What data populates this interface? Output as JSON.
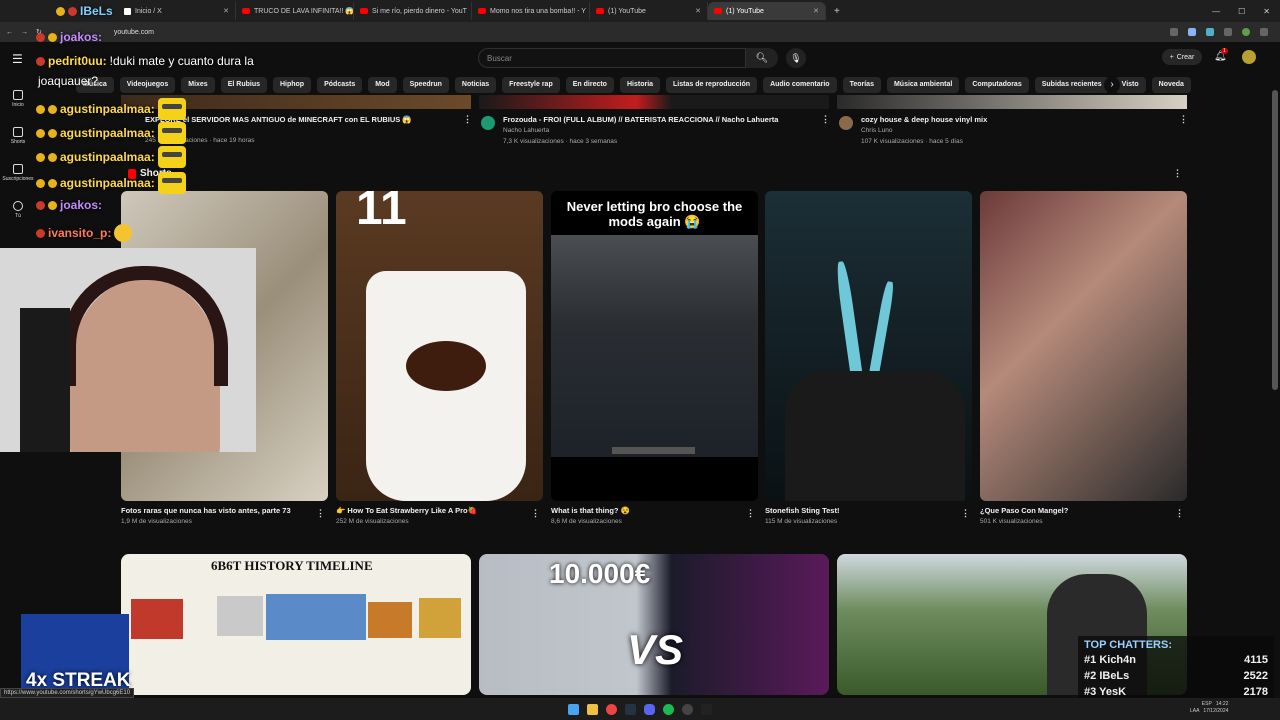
{
  "browser": {
    "tabs": [
      {
        "label": "Inicio / X",
        "icon": "x-icon"
      },
      {
        "label": "TRUCO DE LAVA INFINITA!! 😱",
        "icon": "youtube-icon"
      },
      {
        "label": "Si me río, pierdo dinero - YouT",
        "icon": "youtube-icon"
      },
      {
        "label": "Momo nos tira una bomba!! - Y",
        "icon": "youtube-icon"
      },
      {
        "label": "(1) YouTube",
        "icon": "youtube-icon"
      },
      {
        "label": "(1) YouTube",
        "icon": "youtube-icon",
        "active": true
      }
    ],
    "new_tab": "+",
    "url": "youtube.com"
  },
  "youtube": {
    "search_placeholder": "Buscar",
    "create_label": "Crear",
    "notif_count": "1",
    "chips": [
      "Música",
      "Videojuegos",
      "Mixes",
      "El Rubius",
      "Hiphop",
      "Pódcasts",
      "Mod",
      "Speedrun",
      "Noticias",
      "Freestyle rap",
      "En directo",
      "Historia",
      "Listas de reproducción",
      "Audio comentario",
      "Teorías",
      "Música ambiental",
      "Computadoras",
      "Subidas recientes",
      "Visto",
      "Noveda"
    ],
    "sidebar": [
      {
        "label": "Inicio",
        "icon": "home-icon"
      },
      {
        "label": "Shorts",
        "icon": "shorts-icon"
      },
      {
        "label": "Suscripciones",
        "icon": "subscriptions-icon"
      },
      {
        "label": "Tú",
        "icon": "you-icon"
      }
    ],
    "top_row": [
      {
        "title": "EXPLORE el SERVIDOR MAS ANTIGUO de MINECRAFT con EL RUBIUS 😱",
        "meta": "245 K visualizaciones · hace 19 horas"
      },
      {
        "title": "Frozouda - FROI (FULL ALBUM) // BATERISTA REACCIONA // Nacho Lahuerta",
        "channel": "Nacho Lahuerta",
        "meta": "7,3 K visualizaciones · hace 3 semanas"
      },
      {
        "title": "cozy house & deep house vinyl mix",
        "channel": "Chris Luno",
        "meta": "107 K visualizaciones · hace 5 días"
      }
    ],
    "shorts_label": "Shorts",
    "shorts": [
      {
        "title": "Fotos raras que nunca has visto antes, parte 73",
        "views": "1,9 M de visualizaciones"
      },
      {
        "title": "👉 How To Eat Strawberry Like A Pro🍓",
        "views": "252 M de visualizaciones",
        "overlay": "11"
      },
      {
        "title": "What is that thing? 😵",
        "views": "8,6 M de visualizaciones",
        "overlay": "Never letting bro choose the mods again 😭"
      },
      {
        "title": "Stonefish Sting Test!",
        "views": "115 M de visualizaciones"
      },
      {
        "title": "¿Que Paso Con Mangel?",
        "views": "501 K visualizaciones"
      }
    ],
    "bottom_row": [
      {
        "overlay": "6B6T HISTORY TIMELINE"
      },
      {
        "overlay": "10.000€",
        "overlay2": "VS"
      },
      {
        "overlay": ""
      }
    ],
    "status_url": "https://www.youtube.com/shorts/gYwUbcg6E10"
  },
  "stream": {
    "chat": [
      {
        "user": "IBeLs",
        "text": ""
      },
      {
        "user": "joakos:",
        "text": ""
      },
      {
        "user": "pedrit0uu:",
        "text": "!duki mate y cuanto dura la"
      },
      {
        "user": "",
        "text": "joaquauer?"
      },
      {
        "user": "agustinpaalmaa:",
        "text": ""
      },
      {
        "user": "agustinpaalmaa:",
        "text": ""
      },
      {
        "user": "agustinpaalmaa:",
        "text": ""
      },
      {
        "user": "agustinpaalmaa:",
        "text": ""
      },
      {
        "user": "joakos:",
        "text": ""
      },
      {
        "user": "ivansito_p:",
        "text": ""
      }
    ],
    "streak": "4x STREAK",
    "top_chatters_title": "TOP CHATTERS:",
    "top_chatters": [
      {
        "rank": "#1",
        "name": "Kich4n",
        "count": "4115"
      },
      {
        "rank": "#2",
        "name": "IBeLs",
        "count": "2522"
      },
      {
        "rank": "#3",
        "name": "YesK",
        "count": "2178"
      }
    ]
  },
  "system": {
    "lang": "ESP",
    "lang2": "LAA",
    "time": "14:22",
    "date": "17/12/2024"
  }
}
